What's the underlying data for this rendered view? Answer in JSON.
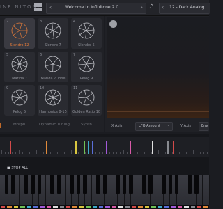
{
  "app": {
    "title": "INFINITONE"
  },
  "header": {
    "preset_name": "Welcome to Infinitone 2.0",
    "scale_preset": "12 - Dark Analog"
  },
  "scales": [
    {
      "num": "2",
      "name": "Slendro 12",
      "active": true
    },
    {
      "num": "3",
      "name": "Slendro 7",
      "active": false
    },
    {
      "num": "4",
      "name": "Slendro 5",
      "active": false
    },
    {
      "num": "5",
      "name": "Marida 7",
      "active": false
    },
    {
      "num": "6",
      "name": "Marida 7 Tone",
      "active": false
    },
    {
      "num": "7",
      "name": "Pelog 9",
      "active": false
    },
    {
      "num": "9",
      "name": "Pelog 5",
      "active": false
    },
    {
      "num": "10",
      "name": "Harmonics 8-15",
      "active": false
    },
    {
      "num": "11",
      "name": "Golden Ratio 10",
      "active": false
    }
  ],
  "tabs": [
    "Morph",
    "Dynamic Tuning",
    "Synth"
  ],
  "xy": {
    "x_label": "X Axis",
    "x_value": "LFO Amount",
    "y_label": "Y Axis",
    "y_value": "Env"
  },
  "controls": {
    "stop_all": "STOP ALL"
  },
  "pitch_colors": [
    "#d24a4a",
    "#e08a3a",
    "#d8c640",
    "#6fc057",
    "#3fa9c9",
    "#5a6fd8",
    "#a25ad8",
    "#d85aa8",
    "#e0e0e0",
    "#888a90"
  ]
}
